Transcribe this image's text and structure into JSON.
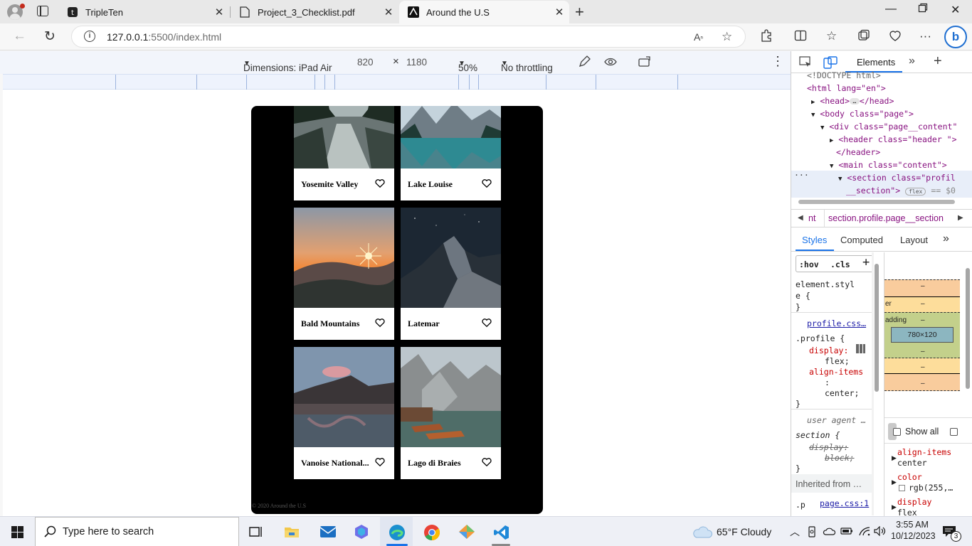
{
  "browser": {
    "tabs": [
      {
        "title": "TripleTen",
        "active": false
      },
      {
        "title": "Project_3_Checklist.pdf",
        "active": false
      },
      {
        "title": "Around the U.S",
        "active": true
      }
    ],
    "url_host": "127.0.0.1",
    "url_rest": ":5500/index.html"
  },
  "device_toolbar": {
    "dimensions_label": "Dimensions: iPad Air",
    "width": "820",
    "times": "×",
    "height": "1180",
    "zoom": "50%",
    "throttling": "No throttling"
  },
  "page": {
    "cards": [
      {
        "name": "Yosemite Valley"
      },
      {
        "name": "Lake Louise"
      },
      {
        "name": "Bald Mountains"
      },
      {
        "name": "Latemar"
      },
      {
        "name": "Vanoise National..."
      },
      {
        "name": "Lago di Braies"
      }
    ],
    "footer": "© 2020 Around the U.S"
  },
  "devtools": {
    "tab_elements": "Elements",
    "dom": {
      "doctype": "<!DOCTYPE html>",
      "html_open": "<html lang=\"en\">",
      "head": "<head>",
      "head_close": "</head>",
      "body": "<body class=\"page\">",
      "div": "<div class=\"page__content\"",
      "header": "<header class=\"header \">",
      "header_close": "</header>",
      "main": "<main class=\"content\">",
      "section": "<section class=\"profil",
      "section2": "__section\">",
      "flex_badge": "flex",
      "eq": "== $0"
    },
    "breadcrumb": "section.profile.page__section",
    "breadcrumb_prefix": "nt",
    "subtabs": [
      "Styles",
      "Computed",
      "Layout"
    ],
    "styles": {
      "hov": ":hov",
      "cls": ".cls",
      "element_style_1": "element.styl",
      "element_style_2": "e {",
      "close": "}",
      "source": "profile.css…",
      "selector": ".profile {",
      "p1": "display:",
      "p1v": "flex;",
      "p2": "align-items",
      "p2c": ":",
      "p2v": "center;",
      "ua": "user agent …",
      "section_sel": "section {",
      "ua_prop": "display:",
      "ua_val": "block;",
      "inherited": "Inherited from …",
      "inh_sel": ".p",
      "inh_src": "page.css:1"
    },
    "boxmodel": {
      "content": "780×120",
      "dash": "–",
      "border_label": "er",
      "padding_label": "adding",
      "show_all": "Show all",
      "props": [
        {
          "name": "align-items",
          "value": "center"
        },
        {
          "name": "color",
          "value": "rgb(255,…"
        },
        {
          "name": "display",
          "value": "flex"
        }
      ]
    }
  },
  "taskbar": {
    "search_placeholder": "Type here to search",
    "weather": "65°F  Cloudy",
    "time": "3:55 AM",
    "date": "10/12/2023",
    "notif_count": "3"
  },
  "colors": {
    "accent": "#1a73e8",
    "edge": "#1f6fd1",
    "page_bg": "#000000",
    "card_bg": "#ffffff",
    "margin": "#f9cc9d",
    "border": "#fddd9b",
    "padding": "#c3d08b",
    "content": "#8cb6c0"
  }
}
